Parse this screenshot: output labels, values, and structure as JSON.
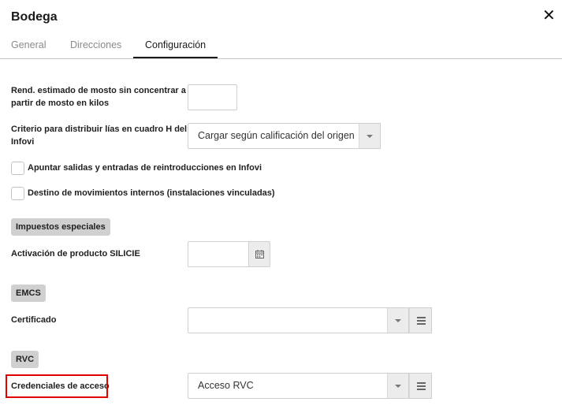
{
  "dialog": {
    "title": "Bodega",
    "close_symbol": "✕"
  },
  "tabs": [
    {
      "label": "General",
      "active": false
    },
    {
      "label": "Direcciones",
      "active": false
    },
    {
      "label": "Configuración",
      "active": true
    }
  ],
  "fields": {
    "rend_estimado": {
      "label_line1": "Rend. estimado de mosto sin concentrar a",
      "label_line2": "partir de mosto en kilos",
      "value": ""
    },
    "criterio": {
      "label_line1": "Criterio para distribuir lías en cuadro H del",
      "label_line2": "Infovi",
      "value": "Cargar según calificación del origen"
    },
    "apuntar_salidas": {
      "label": "Apuntar salidas y entradas de reintroducciones en Infovi",
      "checked": false
    },
    "destino_movimientos": {
      "label": "Destino de movimientos internos (instalaciones vinculadas)",
      "checked": false
    }
  },
  "sections": {
    "impuestos": {
      "title": "Impuestos especiales",
      "activacion_label": "Activación de producto SILICIE",
      "activacion_value": ""
    },
    "emcs": {
      "title": "EMCS",
      "certificado_label": "Certificado",
      "certificado_value": ""
    },
    "rvc": {
      "title": "RVC",
      "credenciales_label": "Credenciales de acceso",
      "credenciales_value": "Acceso RVC"
    }
  },
  "colors": {
    "highlight": "#e00000",
    "section_bg": "#d0d0d0",
    "tab_active": "#1a1a1a",
    "tab_inactive": "#8a8a8a"
  }
}
